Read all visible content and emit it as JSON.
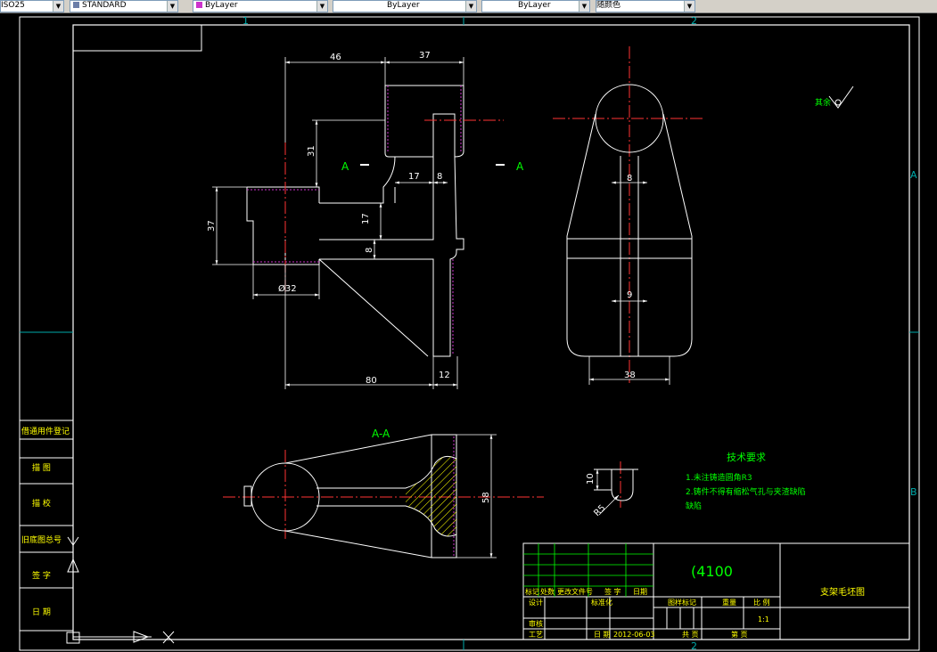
{
  "toolbar": {
    "combo1": "ISO25",
    "combo2": "STANDARD",
    "combo3": "ByLayer",
    "combo4": "ByLayer",
    "combo5": "ByLayer",
    "combo6": "随颜色",
    "layer_color": "#cc33cc"
  },
  "drawing": {
    "zones_top": [
      "1",
      "2"
    ],
    "zones_right": [
      "A",
      "B"
    ],
    "zone_bottom": "2",
    "dims": {
      "d46": "46",
      "d37_top": "37",
      "d31": "31",
      "d17_h": "17",
      "d8_h": "8",
      "d37_left": "37",
      "d17_v": "17",
      "d8_v": "8",
      "d32": "Ø32",
      "d80": "80",
      "d12": "12",
      "d8_right": "8",
      "d9_right": "9",
      "d38": "38",
      "d58": "58",
      "d10": "10",
      "r5": "R5"
    },
    "section_mark_left": "A",
    "section_mark_right": "A",
    "section_title": "A-A",
    "roughness_note": "其余",
    "tech_title": "技术要求",
    "tech_line1": "1.未注铸造圆角R3",
    "tech_line2": "2.铸件不得有缩松气孔与夹渣缺陷",
    "tech_line3": "缺陷"
  },
  "left_column": [
    "借通用件登记",
    "描  图",
    "描  校",
    "旧底图总号",
    "签  字",
    "日  期"
  ],
  "title_block": {
    "material": "(4100",
    "part_name": "支架毛坯图",
    "row_labels": [
      "标记",
      "处数",
      "更改文件号",
      "签  字",
      "日期"
    ],
    "design": "设计",
    "standard": "标准化",
    "stage_label": "图样标记",
    "weight_label": "重量",
    "scale_label": "比 例",
    "scale": "1:1",
    "review": "审核",
    "process": "工艺",
    "date_label": "日 期",
    "date": "2012-06-03",
    "total_sheets": "共  页",
    "sheet": "第  页"
  }
}
